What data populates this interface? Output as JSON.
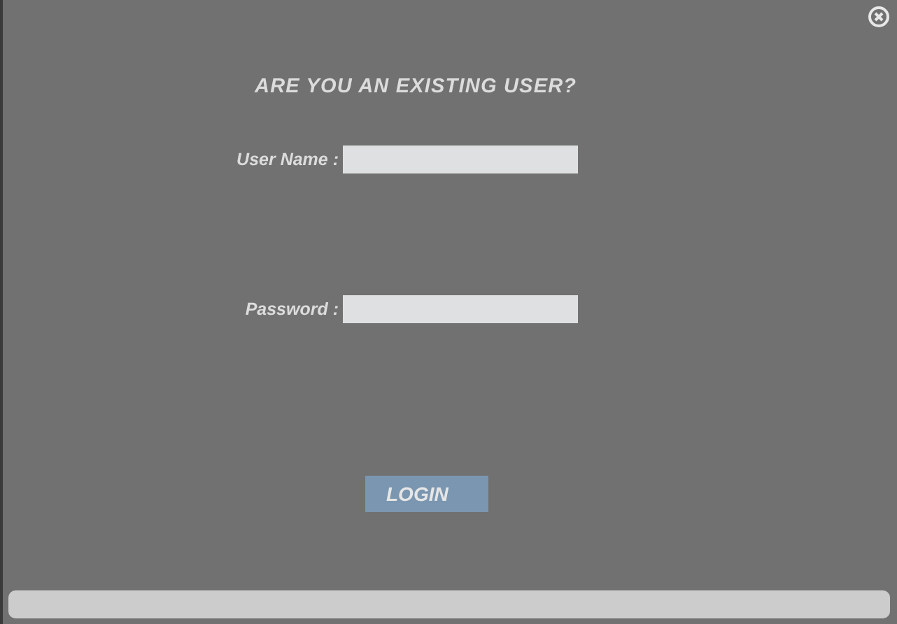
{
  "title": "ARE YOU AN EXISTING USER?",
  "fields": [
    {
      "label": "User Name :"
    },
    {
      "label": "Password :"
    }
  ],
  "login_button": "LOGIN"
}
